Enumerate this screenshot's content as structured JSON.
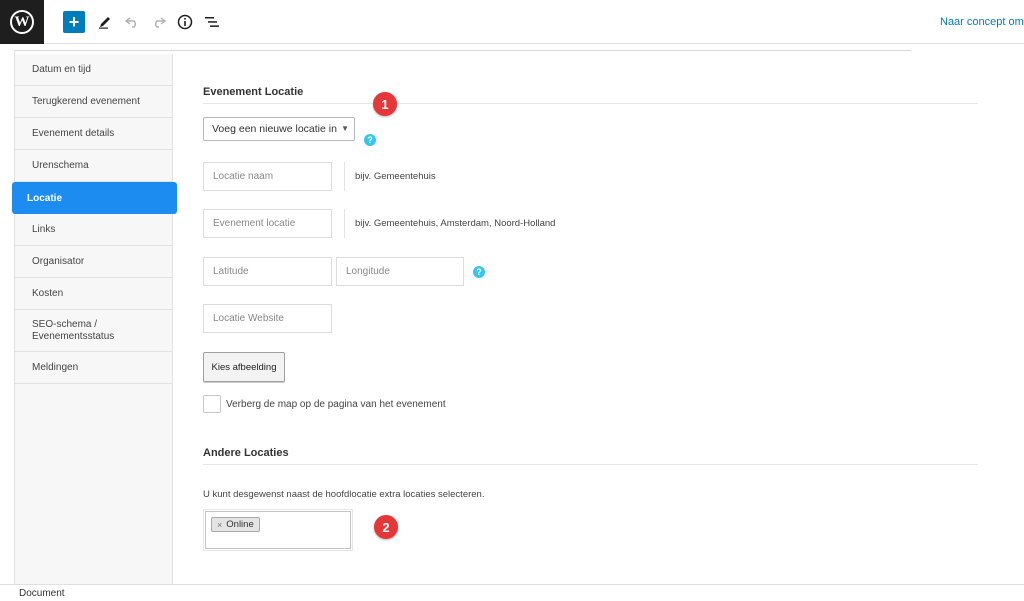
{
  "toolbar": {
    "logo_glyph": "W",
    "add_label": "+",
    "edit_icon": "pencil-icon",
    "undo_icon": "undo-icon",
    "redo_icon": "redo-icon",
    "info_icon": "info-icon",
    "outline_icon": "list-view-icon",
    "draft_link": "Naar concept omzetten",
    "accent": "#007cba"
  },
  "sidebar": {
    "items": [
      {
        "label": "Datum en tijd"
      },
      {
        "label": "Terugkerend evenement"
      },
      {
        "label": "Evenement details"
      },
      {
        "label": "Urenschema"
      },
      {
        "label": "Locatie"
      },
      {
        "label": "Links"
      },
      {
        "label": "Organisator"
      },
      {
        "label": "Kosten"
      },
      {
        "label": "SEO-schema / Evenementsstatus"
      },
      {
        "label": "Meldingen"
      }
    ],
    "active_index": 4,
    "active_color": "#1c8cf0"
  },
  "location": {
    "title": "Evenement Locatie",
    "select_value": "Voeg een nieuwe locatie in",
    "help": "?",
    "name_placeholder": "Locatie naam",
    "name_hint": "bijv. Gemeentehuis",
    "address_placeholder": "Evenement locatie",
    "address_hint": "bijv. Gemeentehuis, Amsterdam, Noord-Holland",
    "lat_placeholder": "Latitude",
    "lng_placeholder": "Longitude",
    "website_placeholder": "Locatie Website",
    "image_button": "Kies afbeelding",
    "hide_map_label": "Verberg de map op de pagina van het evenement"
  },
  "other_locations": {
    "title": "Andere Locaties",
    "description": "U kunt desgewenst naast de hoofdlocatie extra locaties selecteren.",
    "tag_remove": "×",
    "tags": [
      "Online"
    ]
  },
  "annotations": {
    "badge1": "1",
    "badge2": "2",
    "color": "#e5373a"
  },
  "footer": {
    "label": "Document"
  }
}
